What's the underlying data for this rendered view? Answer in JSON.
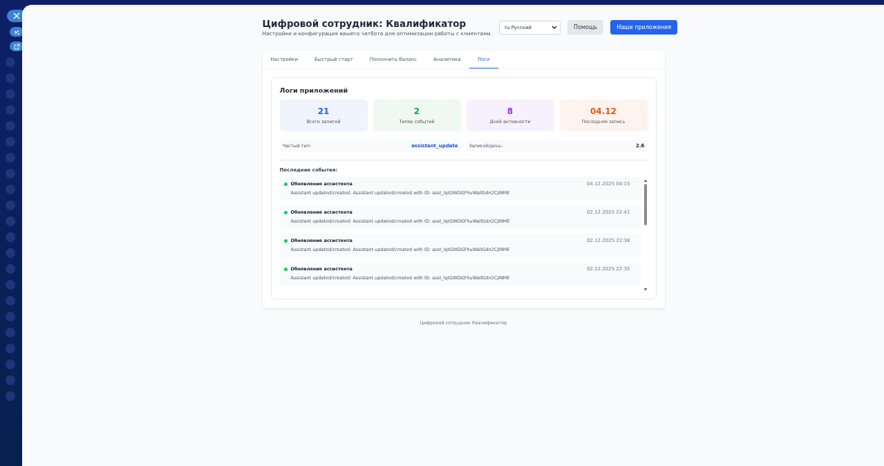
{
  "header": {
    "title": "Цифровой сотрудник: Квалификатор",
    "subtitle": "Настройки и конфигурация вашего чатбота для оптимизации работы с клиентами.",
    "language": "ru Русский",
    "buttons": [
      {
        "label": "Помощь",
        "kind": "secondary"
      },
      {
        "label": "Наши приложения",
        "kind": "primary"
      }
    ]
  },
  "tabs": [
    {
      "label": "Настройки",
      "selected": false
    },
    {
      "label": "Быстрый старт",
      "selected": false
    },
    {
      "label": "Пополнить баланс",
      "selected": false
    },
    {
      "label": "Аналитика",
      "selected": false
    },
    {
      "label": "Логи",
      "selected": true
    }
  ],
  "logs": {
    "title": "Логи приложений",
    "stats": [
      {
        "value": "21",
        "label": "Всего записей",
        "color": "#2563eb"
      },
      {
        "value": "2",
        "label": "Типов событий",
        "color": "#16a34a"
      },
      {
        "value": "8",
        "label": "Дней активности",
        "color": "#9333ea"
      },
      {
        "value": "04.12",
        "label": "Последняя запись",
        "color": "#ea580c"
      }
    ],
    "summary": [
      {
        "label": "Частый тип:",
        "value": "assistant_update",
        "kind": "link"
      },
      {
        "label": "Записей/день:",
        "value": "2.6",
        "kind": "plain"
      }
    ],
    "events_title": "Последние события:",
    "events": [
      {
        "title": "Обновление ассистента",
        "message": "Assistant updated/created: Assistant updated/created with ID: asst_lqtGWDGFhuWallGdn2CjINME",
        "time": "04.12.2025 04:15",
        "color": "#22c55e"
      },
      {
        "title": "Обновление ассистента",
        "message": "Assistant updated/created: Assistant updated/created with ID: asst_lqtGWDGFhuWallGdn2CjINME",
        "time": "02.12.2025 22:41",
        "color": "#22c55e"
      },
      {
        "title": "Обновление ассистента",
        "message": "Assistant updated/created: Assistant updated/created with ID: asst_lqtGWDGFhuWallGdn2CjINME",
        "time": "02.12.2025 22:38",
        "color": "#22c55e"
      },
      {
        "title": "Обновление ассистента",
        "message": "Assistant updated/created: Assistant updated/created with ID: asst_lqtGWDGFhuWallGdn2CjINME",
        "time": "02.12.2025 22:35",
        "color": "#22c55e"
      }
    ]
  },
  "footer": "Цифровой сотрудник Квалификатор"
}
